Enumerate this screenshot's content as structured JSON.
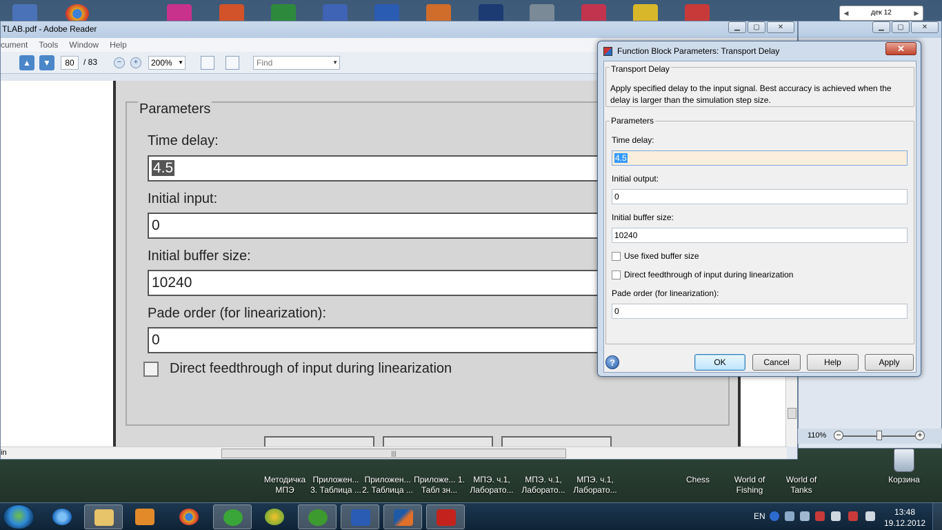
{
  "desktop": {
    "calendar_widget": {
      "label": "дек 12",
      "prev": "◀",
      "next": "▶"
    },
    "shortcuts": [
      "Методичка МПЭ",
      "Приложен... 3. Таблица ...",
      "Приложен... 2. Таблица ...",
      "Приложе... 1. Табл зн...",
      "МПЭ. ч.1, Лаборато...",
      "МПЭ. ч.1, Лаборато...",
      "МПЭ. ч.1, Лаборато...",
      "Chess",
      "World of Fishing",
      "World of Tanks",
      "Корзина"
    ]
  },
  "reader": {
    "title": "TLAB.pdf - Adobe Reader",
    "menu": [
      "cument",
      "Tools",
      "Window",
      "Help"
    ],
    "page_current": "80",
    "page_total": "/ 83",
    "zoom": "200%",
    "find_placeholder": "Find",
    "bottom_left_label": "in",
    "doc": {
      "legend": "Parameters",
      "fields": [
        {
          "label": "Time delay:",
          "value": "4.5"
        },
        {
          "label": "Initial input:",
          "value": "0"
        },
        {
          "label": "Initial buffer size:",
          "value": "10240"
        },
        {
          "label": "Pade order (for linearization):",
          "value": "0"
        }
      ],
      "checkbox_label": "Direct feedthrough of input during linearization"
    }
  },
  "right_window": {
    "zoom_percent": "110%"
  },
  "dialog": {
    "title": "Function Block Parameters: Transport Delay",
    "block_name": "Transport Delay",
    "description": "Apply specified delay to the input signal.  Best accuracy is achieved when the delay is larger than the simulation step size.",
    "params_legend": "Parameters",
    "time_delay_label": "Time delay:",
    "time_delay_value": "4.5",
    "initial_output_label": "Initial output:",
    "initial_output_value": "0",
    "buffer_label": "Initial buffer size:",
    "buffer_value": "10240",
    "fixed_buffer_label": "Use fixed buffer size",
    "fixed_buffer_checked": false,
    "direct_feedthrough_label": "Direct feedthrough of input during linearization",
    "direct_feedthrough_checked": false,
    "pade_label": "Pade order (for linearization):",
    "pade_value": "0",
    "buttons": {
      "ok": "OK",
      "cancel": "Cancel",
      "help": "Help",
      "apply": "Apply"
    }
  },
  "taskbar": {
    "language": "EN",
    "time": "13:48",
    "date": "19.12.2012"
  },
  "colors": {
    "dialog_bg": "#cfdcec",
    "close_button": "#c2452e",
    "selection": "#3399ff",
    "taskbar": "#1c3750"
  }
}
